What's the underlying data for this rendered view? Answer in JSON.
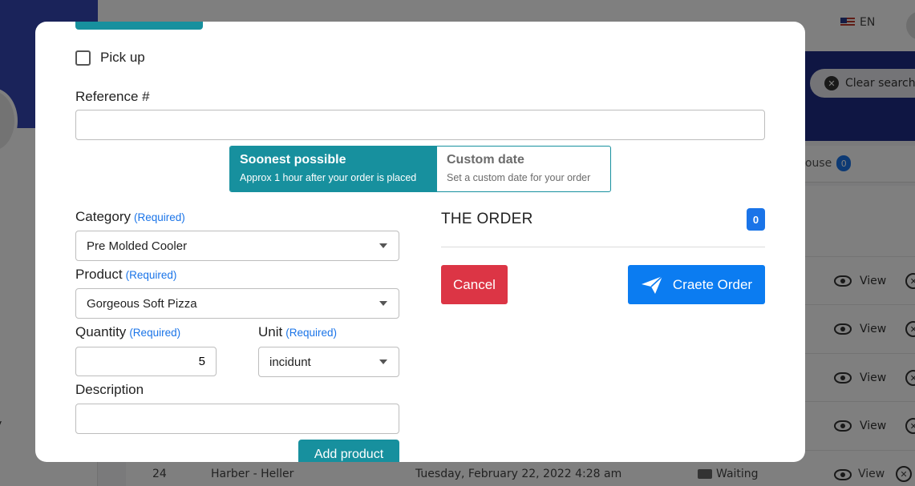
{
  "background": {
    "language": "EN",
    "clear_search_label": "Clear search",
    "warehouse_tab": {
      "label": "house",
      "count": "0"
    },
    "left_rail_text": "y",
    "rows": [
      {
        "action_view": "View"
      },
      {
        "action_view": "View"
      },
      {
        "action_view": "View"
      },
      {
        "action_view": "View"
      },
      {
        "action_view": "View"
      }
    ],
    "last_row": {
      "id": "24",
      "customer": "Harber - Heller",
      "date": "Tuesday, February 22, 2022 4:28 am",
      "status": "Waiting",
      "action_view": "View"
    }
  },
  "modal": {
    "pickup_label": "Pick up",
    "reference": {
      "label": "Reference #",
      "value": "",
      "placeholder": ""
    },
    "delivery_options": [
      {
        "title": "Soonest possible",
        "subtitle": "Approx 1 hour after your order is placed"
      },
      {
        "title": "Custom date",
        "subtitle": "Set a custom date for your order"
      }
    ],
    "required_text": "(Required)",
    "category": {
      "label": "Category",
      "value": "Pre Molded Cooler"
    },
    "product": {
      "label": "Product",
      "value": "Gorgeous Soft Pizza"
    },
    "quantity": {
      "label": "Quantity",
      "value": "5"
    },
    "unit": {
      "label": "Unit",
      "value": "incidunt"
    },
    "description": {
      "label": "Description",
      "value": ""
    },
    "add_product_label": "Add product",
    "order": {
      "title": "THE ORDER",
      "count": "0",
      "cancel_label": "Cancel",
      "create_label": "Craete Order"
    }
  },
  "colors": {
    "teal": "#17909e",
    "primary_blue": "#0b7cf1",
    "danger_red": "#dc3545",
    "required_blue": "#1a74e8",
    "hero_navy": "#1f2d86"
  },
  "icons": {
    "create_order": "paper-plane-icon",
    "pickup": "checkbox",
    "select": "caret-down-icon"
  }
}
